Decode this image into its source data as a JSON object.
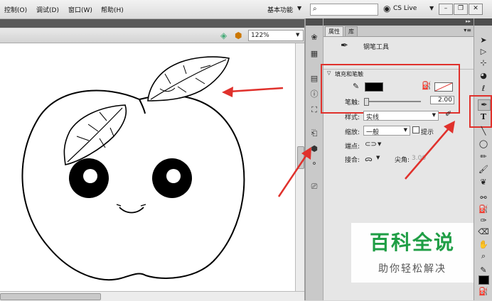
{
  "menubar": {
    "items": [
      "控制(O)",
      "调试(D)",
      "窗口(W)",
      "帮助(H)"
    ],
    "workspace": "基本功能",
    "search_placeholder": "",
    "cslive": "CS Live"
  },
  "stage": {
    "zoom": "122%"
  },
  "panel": {
    "tab_properties": "属性",
    "tab_library": "库",
    "tool_name": "钢笔工具",
    "section_fill_stroke": "填充和笔触",
    "stroke_label": "笔触:",
    "stroke_value": "2.00",
    "style_label": "样式:",
    "style_value": "实线",
    "scale_label": "缩放:",
    "scale_value": "一般",
    "hint_label": "提示",
    "cap_label": "端点:",
    "join_label": "接合:",
    "miter_label": "尖角:",
    "miter_value": "3.00"
  },
  "watermark": {
    "title": "百科全说",
    "subtitle": "助你轻松解决"
  },
  "colors": {
    "accent_red": "#e0312c",
    "watermark_green": "#1f9e45",
    "stroke_color": "#000000"
  }
}
